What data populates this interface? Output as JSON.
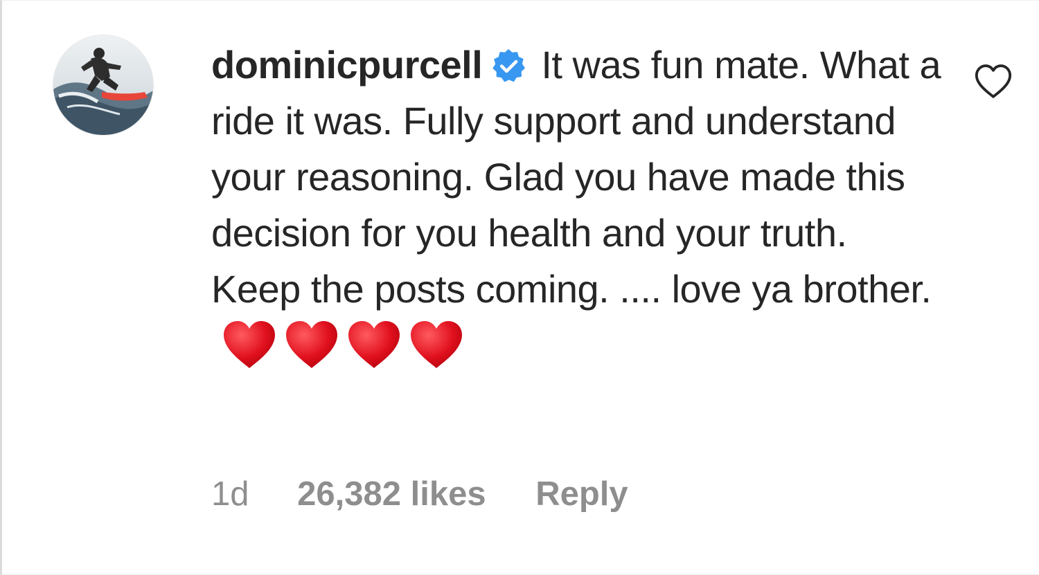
{
  "comment": {
    "username": "dominicpurcell",
    "verified": true,
    "text": "It was fun mate. What a ride it was. Fully support and understand your reasoning. Glad you have made this decision for you health and your truth. Keep the posts coming. .... love ya brother.",
    "emoji": [
      "red-heart",
      "red-heart",
      "red-heart",
      "red-heart"
    ],
    "time": "1d",
    "likes": "26,382 likes",
    "reply_label": "Reply"
  },
  "icons": {
    "avatar": "profile-photo-surfer",
    "verified": "verified-badge-icon",
    "like": "heart-outline-icon"
  },
  "colors": {
    "text": "#262626",
    "secondary": "#8e8e8e",
    "verified_blue": "#3897f0",
    "heart_red": "#e0101e"
  }
}
